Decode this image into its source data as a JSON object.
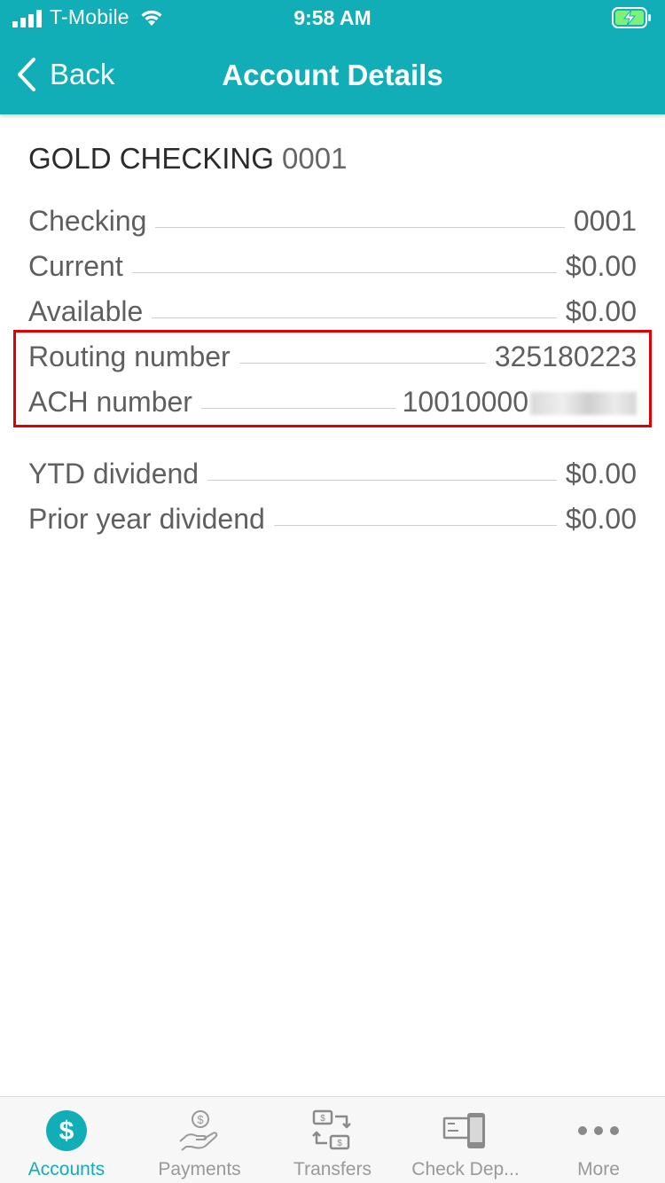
{
  "status_bar": {
    "carrier": "T-Mobile",
    "time": "9:58 AM",
    "icons": [
      "signal-icon",
      "wifi-icon",
      "battery-charging-icon"
    ]
  },
  "nav": {
    "back_label": "Back",
    "title": "Account Details"
  },
  "account": {
    "name": "GOLD CHECKING",
    "number": "0001"
  },
  "details": [
    {
      "label": "Checking",
      "value": "0001"
    },
    {
      "label": "Current",
      "value": "$0.00"
    },
    {
      "label": "Available",
      "value": "$0.00"
    },
    {
      "label": "Routing number",
      "value": "325180223"
    },
    {
      "label": "ACH number",
      "value": "10010000"
    },
    {
      "label": "YTD dividend",
      "value": "$0.00"
    },
    {
      "label": "Prior year dividend",
      "value": "$0.00"
    }
  ],
  "tabs": [
    {
      "label": "Accounts",
      "icon": "dollar-circle-icon",
      "active": true
    },
    {
      "label": "Payments",
      "icon": "hand-dollar-icon",
      "active": false
    },
    {
      "label": "Transfers",
      "icon": "transfer-icon",
      "active": false
    },
    {
      "label": "Check Dep...",
      "icon": "check-deposit-icon",
      "active": false
    },
    {
      "label": "More",
      "icon": "more-dots-icon",
      "active": false
    }
  ],
  "colors": {
    "header": "#12aeb7",
    "accent": "#12aeb7",
    "highlight_border": "#e00000"
  }
}
